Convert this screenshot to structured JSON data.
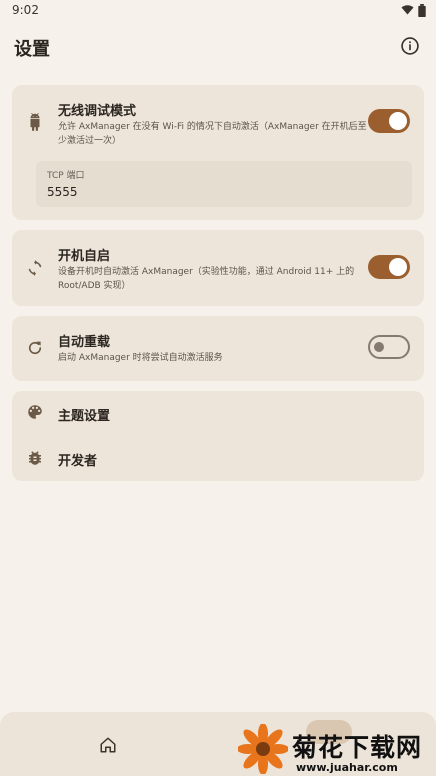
{
  "status_bar": {
    "time": "9:02"
  },
  "app_bar": {
    "title": "设置"
  },
  "wireless": {
    "title": "无线调试模式",
    "subtitle": "允许 AxManager 在没有 Wi-Fi 的情况下自动激活（AxManager 在开机后至少激活过一次）",
    "enabled": true,
    "tcp_label": "TCP 端口",
    "tcp_value": "5555"
  },
  "boot": {
    "title": "开机自启",
    "subtitle": "设备开机时自动激活 AxManager（实验性功能，通过 Android 11+ 上的 Root/ADB 实现）",
    "enabled": true
  },
  "reload": {
    "title": "自动重载",
    "subtitle": "启动 AxManager 时将尝试自动激活服务",
    "enabled": false
  },
  "menu": {
    "theme": "主题设置",
    "developer": "开发者"
  },
  "watermark": {
    "name": "菊花下载网",
    "url": "www.juahar.com"
  },
  "colors": {
    "accent": "#9b5f2f",
    "card": "#ede5da",
    "background": "#f6f1ea"
  },
  "icons": {
    "wireless": "android-icon",
    "boot": "restart-icon",
    "reload": "refresh-icon",
    "theme": "palette-icon",
    "developer": "bug-icon",
    "info": "info-icon",
    "home": "home-icon"
  }
}
